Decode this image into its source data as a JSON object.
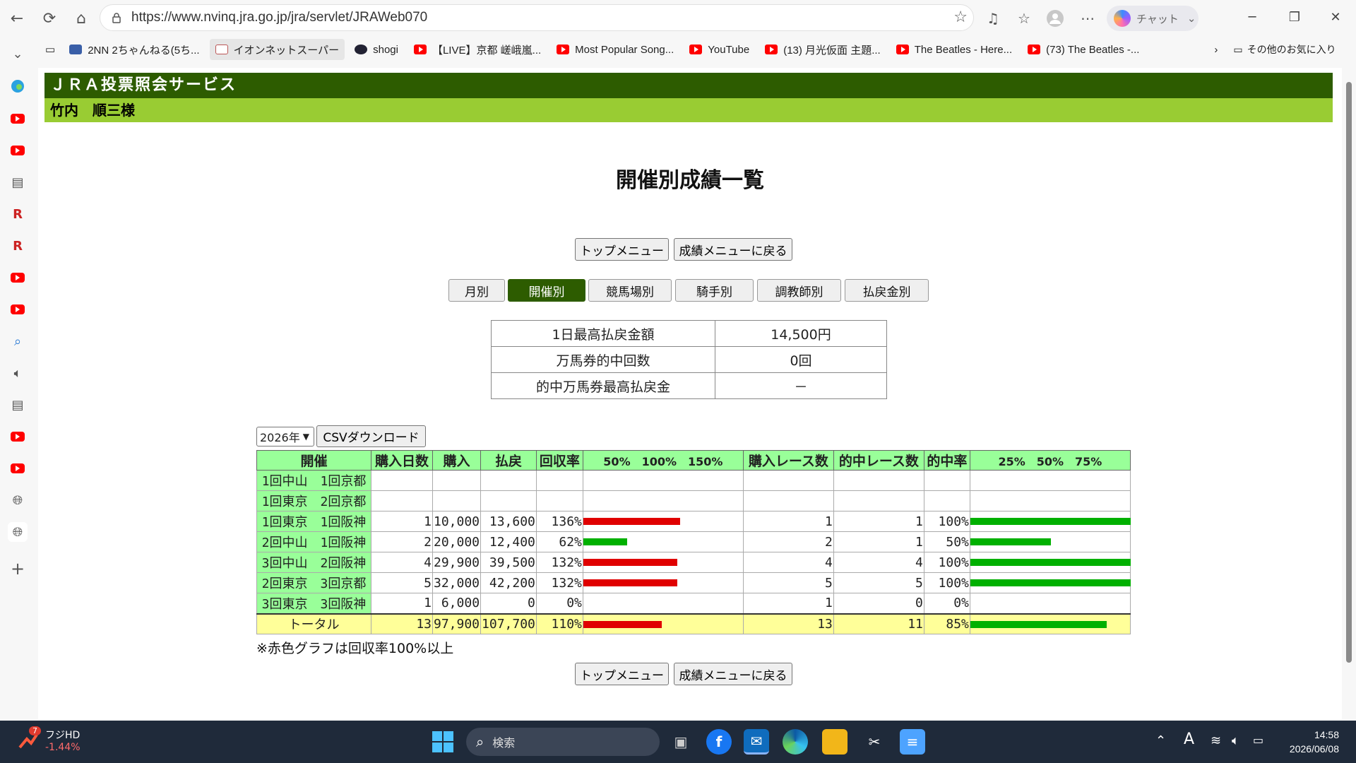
{
  "browser": {
    "url": "https://www.nvinq.jra.go.jp/jra/servlet/JRAWeb070",
    "chat_label": "チャット"
  },
  "favorites": [
    {
      "label": "2NN 2ちゃんねる(5ち...",
      "icon": "2nn-icon"
    },
    {
      "label": "イオンネットスーパー",
      "icon": "home-icon"
    },
    {
      "label": "shogi",
      "icon": "shogi-icon"
    },
    {
      "label": "【LIVE】京都 嵯峨嵐...",
      "icon": "youtube-icon"
    },
    {
      "label": "Most Popular Song...",
      "icon": "youtube-icon"
    },
    {
      "label": "YouTube",
      "icon": "youtube-icon"
    },
    {
      "label": "(13) 月光仮面 主題...",
      "icon": "youtube-icon"
    },
    {
      "label": "The Beatles - Here...",
      "icon": "youtube-icon"
    },
    {
      "label": "(73) The Beatles -...",
      "icon": "youtube-icon"
    }
  ],
  "other_favorites": "その他のお気に入り",
  "page": {
    "service_title": "ＪＲＡ投票照会サービス",
    "user_name": "竹内　順三様",
    "heading": "開催別成績一覧",
    "top_menu_label": "トップメニュー",
    "back_label": "成績メニューに戻る",
    "tabs": [
      {
        "label": "月別",
        "active": false
      },
      {
        "label": "開催別",
        "active": true
      },
      {
        "label": "競馬場別",
        "active": false
      },
      {
        "label": "騎手別",
        "active": false
      },
      {
        "label": "調教師別",
        "active": false
      },
      {
        "label": "払戻金別",
        "active": false
      }
    ],
    "summary": [
      {
        "label": "1日最高払戻金額",
        "value": "14,500円"
      },
      {
        "label": "万馬券的中回数",
        "value": "0回"
      },
      {
        "label": "的中万馬券最高払戻金",
        "value": "－"
      }
    ],
    "year": "2026年",
    "csv_label": "CSVダウンロード",
    "note": "※赤色グラフは回収率100%以上"
  },
  "table": {
    "headers": [
      "開催",
      "購入日数",
      "購入",
      "払戻",
      "回収率",
      "50%　100%　150%",
      "購入レース数",
      "的中レース数",
      "的中率",
      "25%　50%　75%"
    ],
    "rows": [
      {
        "name": "1回中山　1回京都",
        "days": "",
        "buy": "",
        "payout": "",
        "rate": "",
        "rate_pct": 0,
        "races": "",
        "hits": "",
        "hit_rate": "",
        "hit_pct": 0
      },
      {
        "name": "1回東京　2回京都",
        "days": "",
        "buy": "",
        "payout": "",
        "rate": "",
        "rate_pct": 0,
        "races": "",
        "hits": "",
        "hit_rate": "",
        "hit_pct": 0
      },
      {
        "name": "1回東京　1回阪神",
        "days": "1",
        "buy": "10,000",
        "payout": "13,600",
        "rate": "136%",
        "rate_pct": 136,
        "races": "1",
        "hits": "1",
        "hit_rate": "100%",
        "hit_pct": 100
      },
      {
        "name": "2回中山　1回阪神",
        "days": "2",
        "buy": "20,000",
        "payout": "12,400",
        "rate": "62%",
        "rate_pct": 62,
        "races": "2",
        "hits": "1",
        "hit_rate": "50%",
        "hit_pct": 50
      },
      {
        "name": "3回中山　2回阪神",
        "days": "4",
        "buy": "29,900",
        "payout": "39,500",
        "rate": "132%",
        "rate_pct": 132,
        "races": "4",
        "hits": "4",
        "hit_rate": "100%",
        "hit_pct": 100
      },
      {
        "name": "2回東京　3回京都",
        "days": "5",
        "buy": "32,000",
        "payout": "42,200",
        "rate": "132%",
        "rate_pct": 132,
        "races": "5",
        "hits": "5",
        "hit_rate": "100%",
        "hit_pct": 100
      },
      {
        "name": "3回東京　3回阪神",
        "days": "1",
        "buy": "6,000",
        "payout": "0",
        "rate": "0%",
        "rate_pct": 0,
        "races": "1",
        "hits": "0",
        "hit_rate": "0%",
        "hit_pct": 0
      }
    ],
    "total": {
      "name": "トータル",
      "days": "13",
      "buy": "97,900",
      "payout": "107,700",
      "rate": "110%",
      "rate_pct": 110,
      "races": "13",
      "hits": "11",
      "hit_rate": "85%",
      "hit_pct": 85
    }
  },
  "colors": {
    "header_dark": "#2d5c00",
    "header_light": "#99cc33",
    "bar_red": "#e00000",
    "bar_green": "#00b000",
    "table_header": "#99ff99",
    "total_row": "#ffff99"
  },
  "taskbar": {
    "stock_name": "フジHD",
    "stock_change": "-1.44%",
    "stock_badge": "7",
    "search_placeholder": "検索",
    "time": "14:58",
    "date": "2026/06/08"
  }
}
